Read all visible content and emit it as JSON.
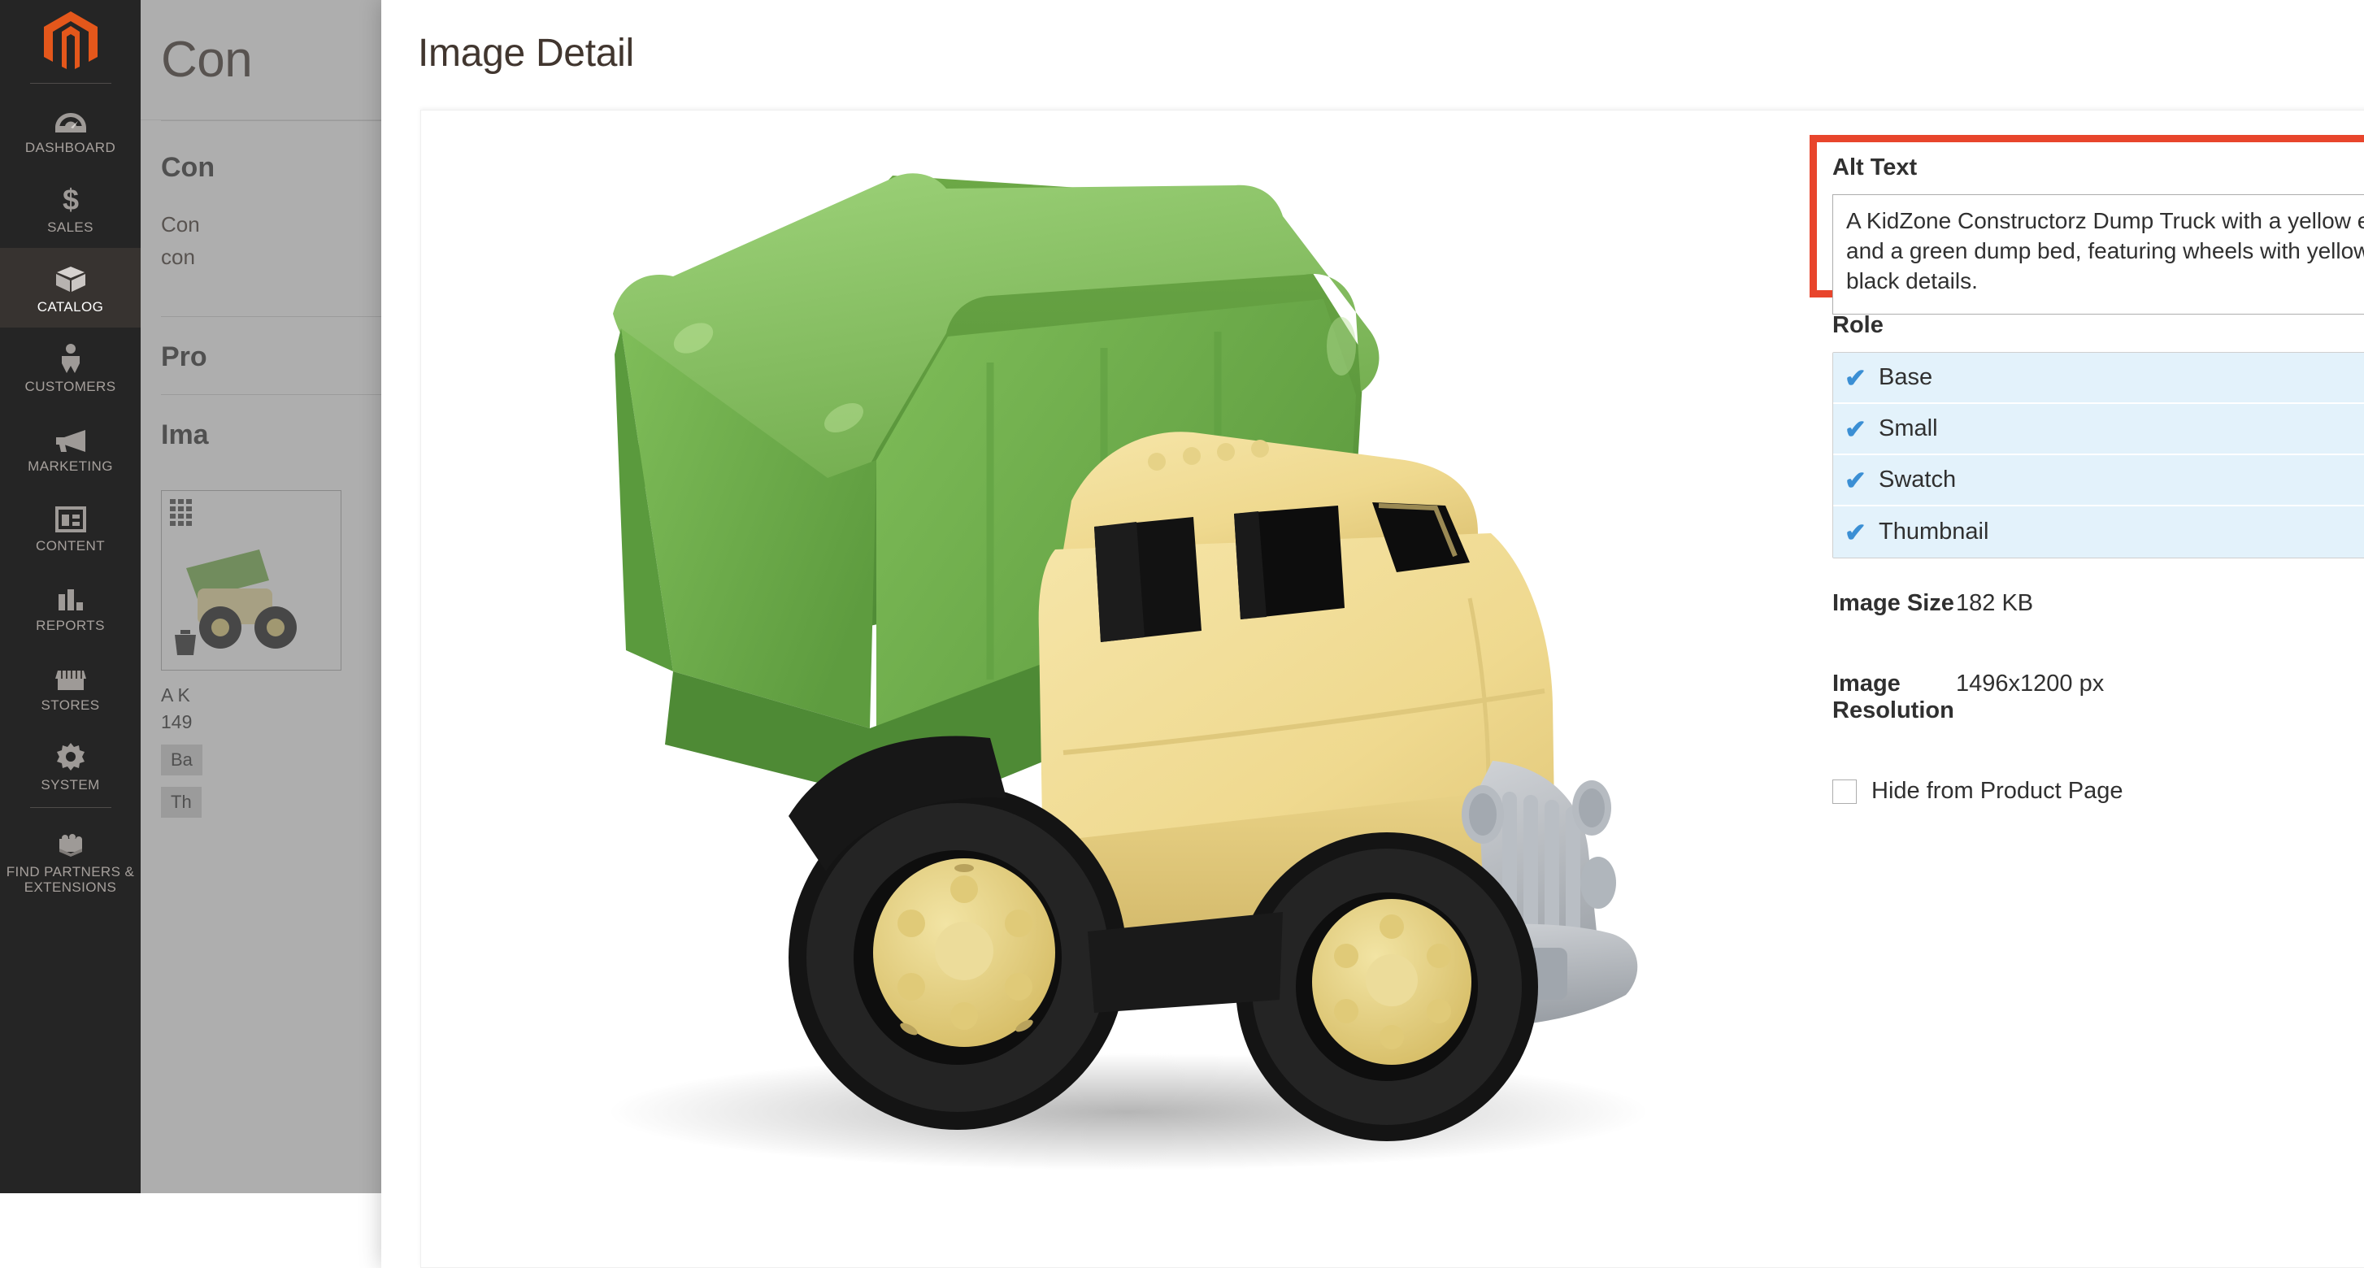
{
  "sidebar": {
    "logo_name": "magento-logo",
    "items": [
      {
        "label": "Dashboard",
        "icon": "dashboard-gauge-icon",
        "active": false
      },
      {
        "label": "Sales",
        "icon": "dollar-sign-icon",
        "active": false
      },
      {
        "label": "Catalog",
        "icon": "box-icon",
        "active": true
      },
      {
        "label": "Customers",
        "icon": "person-icon",
        "active": false
      },
      {
        "label": "Marketing",
        "icon": "megaphone-icon",
        "active": false
      },
      {
        "label": "Content",
        "icon": "layout-icon",
        "active": false
      },
      {
        "label": "Reports",
        "icon": "bar-chart-icon",
        "active": false
      },
      {
        "label": "Stores",
        "icon": "storefront-icon",
        "active": false
      },
      {
        "label": "System",
        "icon": "gear-icon",
        "active": false
      },
      {
        "label": "Find Partners & Extensions",
        "icon": "lego-brick-icon",
        "active": false
      }
    ]
  },
  "page": {
    "title": "Con",
    "section_title": "Con",
    "section_note_line1": "Con",
    "section_note_line2": "con",
    "products_title": "Pro",
    "images_title": "Ima",
    "tile": {
      "alt": "A K",
      "resolution": "149",
      "badges": [
        "Ba",
        "Th"
      ]
    }
  },
  "modal": {
    "title": "Image Detail",
    "close_icon": "close-icon",
    "preview_image_name": "kidzone-constructorz-dump-truck",
    "alt_text": {
      "label": "Alt Text",
      "value": "A KidZone Constructorz Dump Truck with a yellow exterior and a green dump bed, featuring wheels with yellow and black details.",
      "placeholder": "",
      "highlight_color": "#e8452c"
    },
    "role": {
      "label": "Role",
      "options": [
        {
          "label": "Base",
          "selected": true
        },
        {
          "label": "Small",
          "selected": true
        },
        {
          "label": "Swatch",
          "selected": true
        },
        {
          "label": "Thumbnail",
          "selected": true
        }
      ],
      "check_glyph": "✔",
      "selected_bg": "#e3f2fb",
      "check_color": "#3b8fd4"
    },
    "meta": [
      {
        "key": "Image Size",
        "value": "182 KB"
      },
      {
        "key": "Image Resolution",
        "value": "1496x1200 px"
      }
    ],
    "hide_from_product_page": {
      "label": "Hide from Product Page",
      "checked": false
    }
  }
}
